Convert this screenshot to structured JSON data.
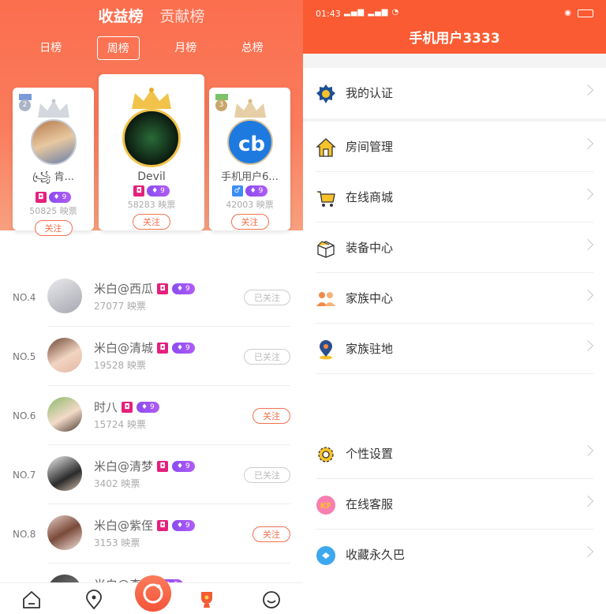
{
  "left": {
    "top_tabs": [
      "收益榜",
      "贡献榜"
    ],
    "period_tabs": [
      "日榜",
      "周榜",
      "月榜",
      "总榜"
    ],
    "podium": [
      {
        "rank": "2",
        "name": "꧁ꦿ 肯...",
        "level": "9",
        "votes": "50825 映票",
        "follow": "关注"
      },
      {
        "rank": "1",
        "name": "Devil",
        "level": "9",
        "votes": "58283 映票",
        "follow": "关注"
      },
      {
        "rank": "3",
        "name": "手机用户6...",
        "level": "9",
        "votes": "42003 映票",
        "follow": "关注"
      }
    ],
    "rows": [
      {
        "no": "NO.4",
        "name": "米白@西瓜",
        "level": "9",
        "votes": "27077 映票",
        "btn": "已关注"
      },
      {
        "no": "NO.5",
        "name": "米白@清城",
        "level": "9",
        "votes": "19528 映票",
        "btn": "已关注"
      },
      {
        "no": "NO.6",
        "name": "时八",
        "level": "9",
        "votes": "15724 映票",
        "btn": "关注"
      },
      {
        "no": "NO.7",
        "name": "米白@清梦",
        "level": "9",
        "votes": "3402 映票",
        "btn": "已关注"
      },
      {
        "no": "NO.8",
        "name": "米白@紫侄",
        "level": "9",
        "votes": "3153 映票",
        "btn": "关注"
      },
      {
        "no": "",
        "name": "米白@森",
        "level": "9",
        "votes": "",
        "btn": ""
      }
    ],
    "tabbar": [
      "home-icon",
      "location-icon",
      "camera-icon",
      "trophy-icon",
      "smile-icon"
    ]
  },
  "right": {
    "status_time": "01:43",
    "title": "手机用户3333",
    "menu1": [
      {
        "label": "我的认证",
        "icon": "badge-gear-icon"
      }
    ],
    "menu2": [
      {
        "label": "房间管理",
        "icon": "house-icon"
      },
      {
        "label": "在线商城",
        "icon": "cart-icon"
      },
      {
        "label": "装备中心",
        "icon": "box-icon"
      },
      {
        "label": "家族中心",
        "icon": "people-icon"
      },
      {
        "label": "家族驻地",
        "icon": "map-pin-icon"
      }
    ],
    "menu3": [
      {
        "label": "个性设置",
        "icon": "gear-icon"
      },
      {
        "label": "在线客服",
        "icon": "kf-icon"
      },
      {
        "label": "收藏永久巴",
        "icon": "bookmark-icon"
      }
    ]
  },
  "colors": {
    "accent": "#fa5b32",
    "pink_badge": "#e4207c",
    "level_badge": "#8a4cf0"
  }
}
